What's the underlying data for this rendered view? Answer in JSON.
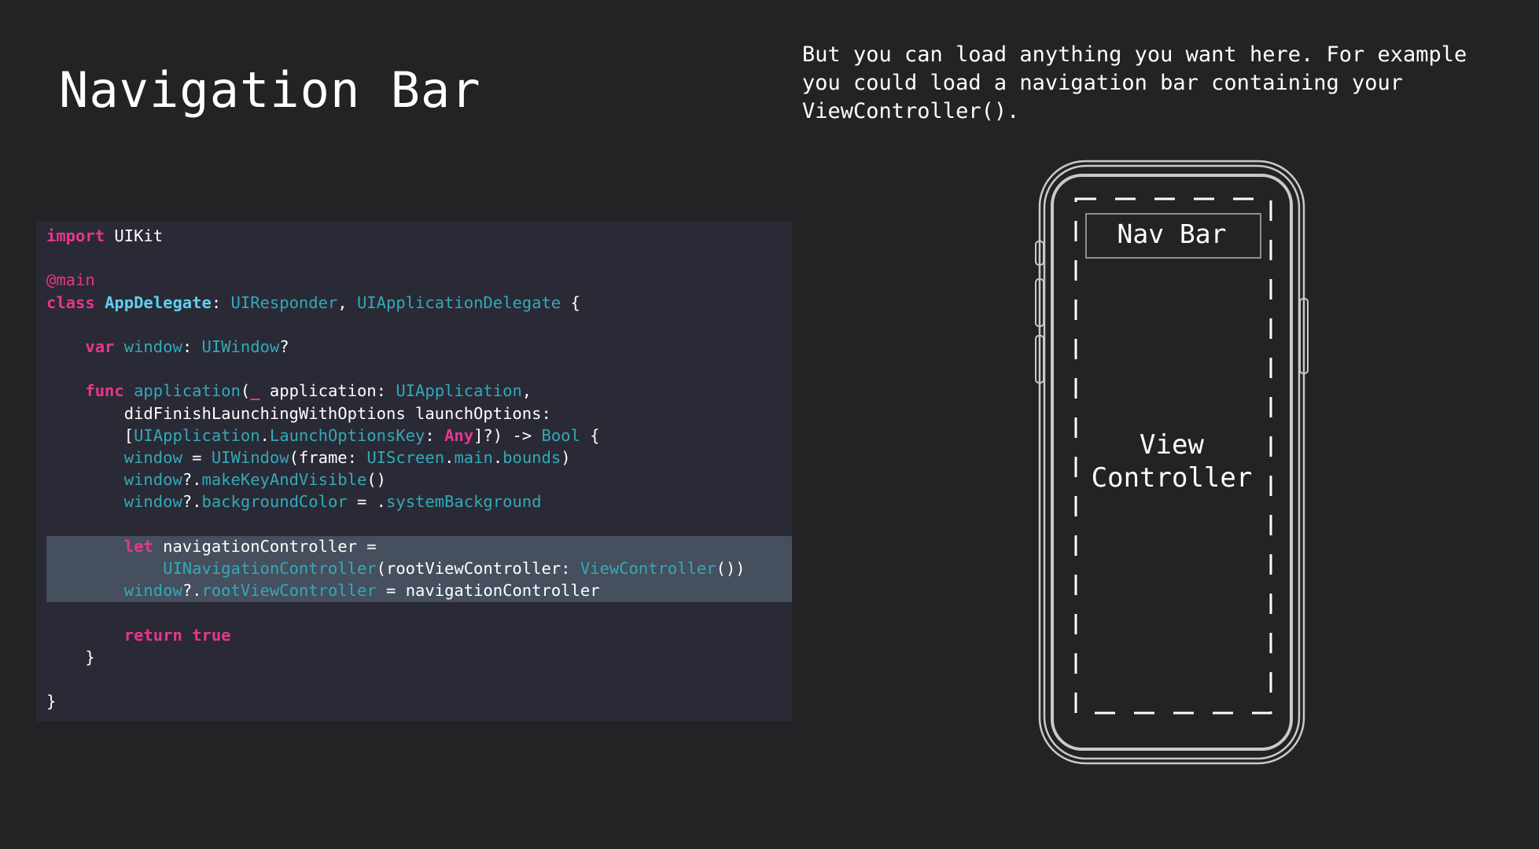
{
  "title": "Navigation Bar",
  "caption": {
    "lines": [
      "But you can load anything you want here. For example",
      "you could load a navigation bar containing your",
      "ViewController()."
    ]
  },
  "code": {
    "lines": [
      [
        {
          "t": "import",
          "c": "kw"
        },
        {
          "t": " UIKit",
          "c": "pln"
        }
      ],
      [],
      [
        {
          "t": "@main",
          "c": "attr"
        }
      ],
      [
        {
          "t": "class",
          "c": "kw"
        },
        {
          "t": " ",
          "c": "pln"
        },
        {
          "t": "AppDelegate",
          "c": "dec"
        },
        {
          "t": ": ",
          "c": "pln"
        },
        {
          "t": "UIResponder",
          "c": "typ"
        },
        {
          "t": ", ",
          "c": "pln"
        },
        {
          "t": "UIApplicationDelegate",
          "c": "typ"
        },
        {
          "t": " {",
          "c": "pln"
        }
      ],
      [],
      [
        {
          "t": "    ",
          "c": "pln"
        },
        {
          "t": "var",
          "c": "kw"
        },
        {
          "t": " ",
          "c": "pln"
        },
        {
          "t": "window",
          "c": "typ"
        },
        {
          "t": ": ",
          "c": "pln"
        },
        {
          "t": "UIWindow",
          "c": "typ"
        },
        {
          "t": "?",
          "c": "pln"
        }
      ],
      [],
      [
        {
          "t": "    ",
          "c": "pln"
        },
        {
          "t": "func",
          "c": "kw"
        },
        {
          "t": " ",
          "c": "pln"
        },
        {
          "t": "application",
          "c": "typ"
        },
        {
          "t": "(",
          "c": "pln"
        },
        {
          "t": "_",
          "c": "kw"
        },
        {
          "t": " application: ",
          "c": "pln"
        },
        {
          "t": "UIApplication",
          "c": "typ"
        },
        {
          "t": ",",
          "c": "pln"
        }
      ],
      [
        {
          "t": "        didFinishLaunchingWithOptions launchOptions:",
          "c": "pln"
        }
      ],
      [
        {
          "t": "        [",
          "c": "pln"
        },
        {
          "t": "UIApplication",
          "c": "typ"
        },
        {
          "t": ".",
          "c": "pln"
        },
        {
          "t": "LaunchOptionsKey",
          "c": "typ"
        },
        {
          "t": ": ",
          "c": "pln"
        },
        {
          "t": "Any",
          "c": "kw"
        },
        {
          "t": "]?) -> ",
          "c": "pln"
        },
        {
          "t": "Bool",
          "c": "typ"
        },
        {
          "t": " {",
          "c": "pln"
        }
      ],
      [
        {
          "t": "        ",
          "c": "pln"
        },
        {
          "t": "window",
          "c": "typ"
        },
        {
          "t": " = ",
          "c": "pln"
        },
        {
          "t": "UIWindow",
          "c": "typ"
        },
        {
          "t": "(frame: ",
          "c": "pln"
        },
        {
          "t": "UIScreen",
          "c": "typ"
        },
        {
          "t": ".",
          "c": "pln"
        },
        {
          "t": "main",
          "c": "typ"
        },
        {
          "t": ".",
          "c": "pln"
        },
        {
          "t": "bounds",
          "c": "typ"
        },
        {
          "t": ")",
          "c": "pln"
        }
      ],
      [
        {
          "t": "        ",
          "c": "pln"
        },
        {
          "t": "window",
          "c": "typ"
        },
        {
          "t": "?.",
          "c": "pln"
        },
        {
          "t": "makeKeyAndVisible",
          "c": "typ"
        },
        {
          "t": "()",
          "c": "pln"
        }
      ],
      [
        {
          "t": "        ",
          "c": "pln"
        },
        {
          "t": "window",
          "c": "typ"
        },
        {
          "t": "?.",
          "c": "pln"
        },
        {
          "t": "backgroundColor",
          "c": "typ"
        },
        {
          "t": " = .",
          "c": "pln"
        },
        {
          "t": "systemBackground",
          "c": "typ"
        }
      ],
      [],
      [
        {
          "t": "        ",
          "c": "pln"
        },
        {
          "t": "let",
          "c": "kw"
        },
        {
          "t": " navigationController =",
          "c": "pln"
        }
      ],
      [
        {
          "t": "            ",
          "c": "pln"
        },
        {
          "t": "UINavigationController",
          "c": "typ"
        },
        {
          "t": "(rootViewController: ",
          "c": "pln"
        },
        {
          "t": "ViewController",
          "c": "typ"
        },
        {
          "t": "())",
          "c": "pln"
        }
      ],
      [
        {
          "t": "        ",
          "c": "pln"
        },
        {
          "t": "window",
          "c": "typ"
        },
        {
          "t": "?.",
          "c": "pln"
        },
        {
          "t": "rootViewController",
          "c": "typ"
        },
        {
          "t": " = navigationController",
          "c": "pln"
        }
      ],
      [],
      [
        {
          "t": "        ",
          "c": "pln"
        },
        {
          "t": "return",
          "c": "kw"
        },
        {
          "t": " ",
          "c": "pln"
        },
        {
          "t": "true",
          "c": "kw"
        }
      ],
      [
        {
          "t": "    }",
          "c": "pln"
        }
      ],
      [],
      [
        {
          "t": "}",
          "c": "pln"
        }
      ]
    ]
  },
  "diagram": {
    "nav_bar_label": "Nav Bar",
    "view_controller_label": [
      "View",
      "Controller"
    ]
  },
  "colors": {
    "background": "#232224",
    "code_background": "#292a36",
    "highlight": "#454f5e",
    "keyword": "#e8368d",
    "type": "#34a9b8",
    "declaration": "#5fd0ee"
  }
}
